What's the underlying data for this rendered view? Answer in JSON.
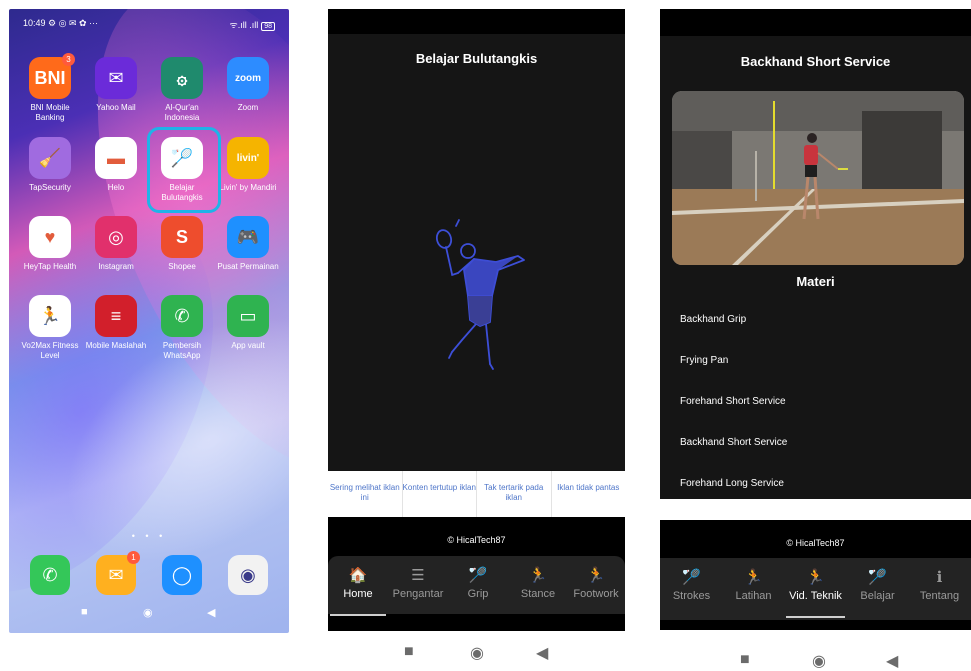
{
  "panel1": {
    "status": {
      "time": "10:49",
      "indicators": "⚙ ◎ ✉ ✿ ···",
      "signal": "ᯤ.ıll .ıll",
      "battery": "98"
    },
    "apps": [
      {
        "label": "BNI Mobile Banking",
        "glyph": "BNI",
        "color": "#ff6a1a",
        "badge": "3"
      },
      {
        "label": "Yahoo Mail",
        "glyph": "✉",
        "color": "#6b2bd9"
      },
      {
        "label": "Al-Qur'an Indonesia",
        "glyph": "۞",
        "color": "#1f8a6d"
      },
      {
        "label": "Zoom",
        "glyph": "zoom",
        "color": "#2d8cff"
      },
      {
        "label": "TapSecurity",
        "glyph": "🧹",
        "color": "#a06be0"
      },
      {
        "label": "Helo",
        "glyph": "▬",
        "color": "#ffffff"
      },
      {
        "label": "Belajar Bulutangkis",
        "glyph": "🏸",
        "color": "#ffffff"
      },
      {
        "label": "Livin' by Mandiri",
        "glyph": "livin'",
        "color": "#f5b400"
      },
      {
        "label": "HeyTap Health",
        "glyph": "♥",
        "color": "#ffffff"
      },
      {
        "label": "Instagram",
        "glyph": "◎",
        "color": "#e1306c"
      },
      {
        "label": "Shopee",
        "glyph": "S",
        "color": "#ee4d2d"
      },
      {
        "label": "Pusat Permainan",
        "glyph": "🎮",
        "color": "#1e90ff"
      },
      {
        "label": "Vo2Max Fitness Level",
        "glyph": "🏃",
        "color": "#ffffff"
      },
      {
        "label": "Mobile Maslahah",
        "glyph": "≡",
        "color": "#d21f2b"
      },
      {
        "label": "Pembersih WhatsApp",
        "glyph": "✆",
        "color": "#2fb350"
      },
      {
        "label": "App vault",
        "glyph": "▭",
        "color": "#2fb350"
      }
    ],
    "dots": "• • •",
    "dock": [
      {
        "label": "Phone",
        "glyph": "✆",
        "color": "#34c759"
      },
      {
        "label": "Messages",
        "glyph": "✉",
        "color": "#ffb01f",
        "badge": "1"
      },
      {
        "label": "Chat",
        "glyph": "◯",
        "color": "#1e90ff"
      },
      {
        "label": "Camera",
        "glyph": "◉",
        "color": "#f2f2f2"
      }
    ]
  },
  "panel2": {
    "title": "Belajar Bulutangkis",
    "ads": [
      "Sering melihat iklan ini",
      "Konten tertutup iklan",
      "Tak tertarik pada iklan",
      "Iklan tidak pantas"
    ],
    "copyright": "© HicalTech87",
    "tabs": [
      {
        "icon": "home-icon",
        "glyph": "🏠",
        "label": "Home",
        "active": true
      },
      {
        "icon": "list-icon",
        "glyph": "☰",
        "label": "Pengantar"
      },
      {
        "icon": "racket-icon",
        "glyph": "🏸",
        "label": "Grip"
      },
      {
        "icon": "player-icon",
        "glyph": "🏃",
        "label": "Stance"
      },
      {
        "icon": "player-icon",
        "glyph": "🏃",
        "label": "Footwork"
      }
    ]
  },
  "panel3": {
    "title": "Backhand Short Service",
    "materi_heading": "Materi",
    "materi": [
      "Backhand Grip",
      "Frying Pan",
      "Forehand Short Service",
      "Backhand Short Service",
      "Forehand Long Service"
    ],
    "copyright": "© HicalTech87",
    "tabs": [
      {
        "icon": "strokes-icon",
        "glyph": "🏸",
        "label": "Strokes"
      },
      {
        "icon": "latihan-icon",
        "glyph": "🏃",
        "label": "Latihan"
      },
      {
        "icon": "video-technique-icon",
        "glyph": "🏃",
        "label": "Vid. Teknik",
        "active": true
      },
      {
        "icon": "belajar-icon",
        "glyph": "🏸",
        "label": "Belajar"
      },
      {
        "icon": "info-icon",
        "glyph": "ℹ",
        "label": "Tentang"
      }
    ]
  },
  "sysnav": {
    "recents": "■",
    "home": "◉",
    "back": "◀"
  },
  "colors": {
    "accent_blue": "#4f76c9",
    "highlight": "#1fb3e8",
    "tab_active": "#ffffff",
    "tab_inactive": "#9a9a9a"
  }
}
